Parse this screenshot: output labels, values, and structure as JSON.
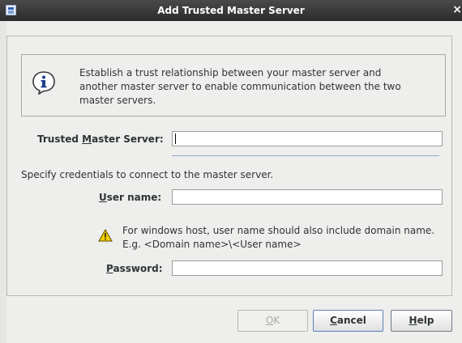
{
  "window": {
    "title": "Add Trusted Master Server",
    "close_glyph": "×"
  },
  "info": {
    "icon": "info-icon",
    "text": "Establish a trust relationship between your master server and another master server to enable communication between the two master servers."
  },
  "trusted_server": {
    "label_pre": "Trusted ",
    "label_mnemonic": "M",
    "label_post": "aster Server:",
    "value": ""
  },
  "credentials": {
    "instruction": "Specify credentials to connect to the master server.",
    "username_mnemonic": "U",
    "username_label_post": "ser name:",
    "username_value": "",
    "warning_icon": "warning-icon",
    "warning_text": "For windows host, user name should also include domain name. E.g. <Domain name>\\<User name>",
    "password_mnemonic": "P",
    "password_label_post": "assword:",
    "password_value": ""
  },
  "buttons": {
    "ok_mnemonic": "O",
    "ok_post": "K",
    "cancel_mnemonic": "C",
    "cancel_post": "ancel",
    "help_mnemonic": "H",
    "help_post": "elp"
  },
  "colors": {
    "titlebar": "#2b2b2b",
    "dialog_bg": "#eeeeec",
    "separator": "#8fa6c7",
    "warning": "#f5d000"
  }
}
